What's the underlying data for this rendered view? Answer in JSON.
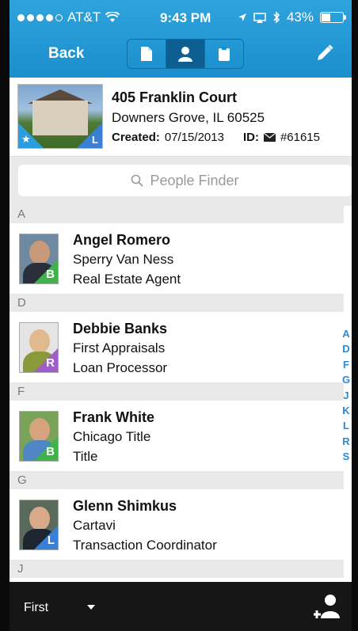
{
  "status": {
    "carrier": "AT&T",
    "time": "9:43 PM",
    "battery": "43%",
    "battery_level": 0.43
  },
  "nav": {
    "back_label": "Back",
    "segments": [
      {
        "icon": "document-icon"
      },
      {
        "icon": "person-icon",
        "active": true
      },
      {
        "icon": "clipboard-icon"
      }
    ],
    "edit_icon": "pencil-icon"
  },
  "property": {
    "address_line1": "405 Franklin Court",
    "address_line2": "Downers Grove, IL 60525",
    "created_label": "Created:",
    "created_date": "07/15/2013",
    "id_label": "ID:",
    "id_value": "#61615",
    "badge_left": "★",
    "badge_right": "L"
  },
  "search": {
    "placeholder": "People Finder"
  },
  "contacts": {
    "sections": [
      {
        "letter": "A",
        "name": "Angel Romero",
        "company": "Sperry Van Ness",
        "role": "Real Estate Agent",
        "badge": "B",
        "badge_color": "#3db34a"
      },
      {
        "letter": "D",
        "name": "Debbie Banks",
        "company": "First Appraisals",
        "role": "Loan Processor",
        "badge": "R",
        "badge_color": "#a05cc8"
      },
      {
        "letter": "F",
        "name": "Frank White",
        "company": "Chicago Title",
        "role": "Title",
        "badge": "B",
        "badge_color": "#3db34a"
      },
      {
        "letter": "G",
        "name": "Glenn Shimkus",
        "company": "Cartavi",
        "role": "Transaction Coordinator",
        "badge": "L",
        "badge_color": "#3a7fd6"
      }
    ],
    "next_section_letter": "J"
  },
  "index_letters": [
    "A",
    "D",
    "F",
    "G",
    "J",
    "K",
    "L",
    "R",
    "S"
  ],
  "bottom": {
    "sort_label": "First"
  }
}
